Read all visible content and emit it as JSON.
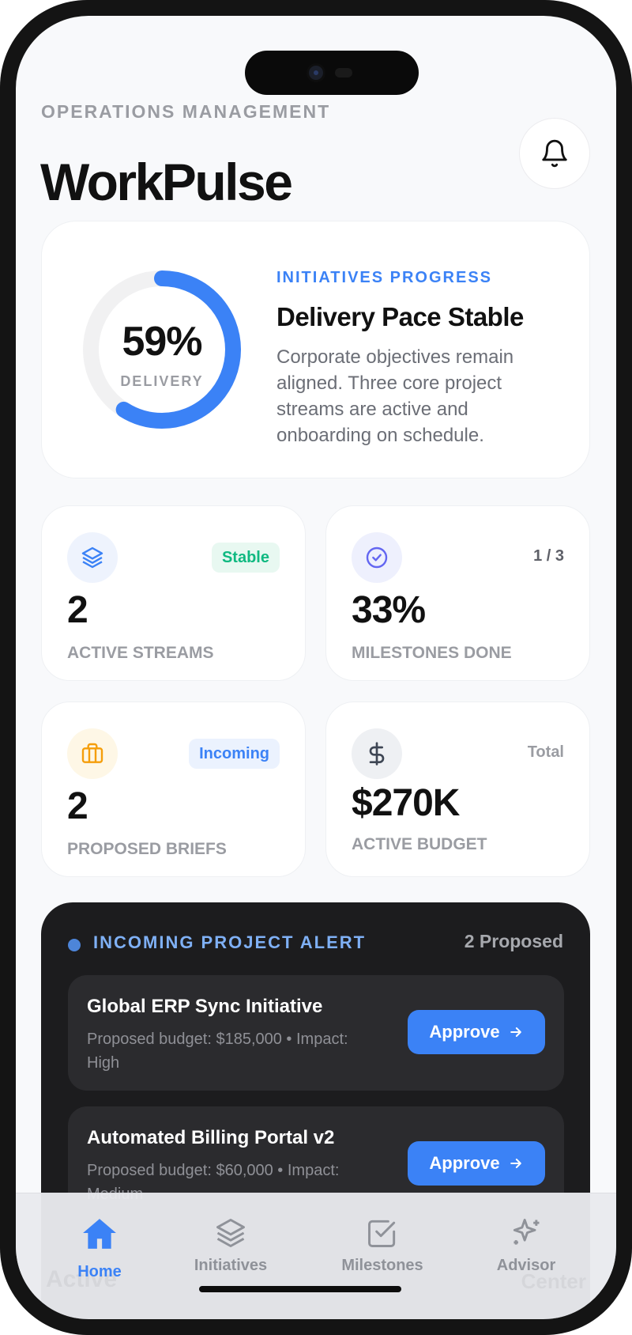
{
  "header": {
    "eyebrow": "OPERATIONS MANAGEMENT",
    "title": "WorkPulse",
    "bell_icon": "bell-icon"
  },
  "hero": {
    "progress": 59,
    "progress_text": "59%",
    "progress_label": "DELIVERY",
    "eyebrow": "INITIATIVES PROGRESS",
    "title": "Delivery Pace Stable",
    "description": "Corporate objectives remain aligned. Three core project streams are active and onboarding on schedule.",
    "accent": "#3b82f6"
  },
  "stats": [
    {
      "icon": "layers-icon",
      "badge": "Stable",
      "value": "2",
      "label": "ACTIVE STREAMS",
      "badge_color": "#10b981"
    },
    {
      "icon": "check-circle-icon",
      "tag": "1 / 3",
      "value": "33%",
      "label": "MILESTONES DONE"
    },
    {
      "icon": "briefcase-icon",
      "badge": "Incoming",
      "value": "2",
      "label": "PROPOSED BRIEFS",
      "badge_color": "#3b82f6"
    },
    {
      "icon": "dollar-icon",
      "tag": "Total",
      "value": "$270K",
      "label": "ACTIVE BUDGET"
    }
  ],
  "alert": {
    "title": "INCOMING PROJECT ALERT",
    "count": "2 Proposed",
    "proposals": [
      {
        "name": "Global ERP Sync Initiative",
        "meta": "Proposed budget: $185,000 • Impact: High",
        "action": "Approve"
      },
      {
        "name": "Automated Billing Portal v2",
        "meta": "Proposed budget: $60,000 • Impact: Medium",
        "action": "Approve"
      }
    ]
  },
  "tabbar": {
    "tabs": [
      {
        "label": "Home",
        "icon": "home-icon",
        "active": true
      },
      {
        "label": "Initiatives",
        "icon": "layers-icon",
        "active": false
      },
      {
        "label": "Milestones",
        "icon": "checkbox-icon",
        "active": false
      },
      {
        "label": "Advisor",
        "icon": "sparkles-icon",
        "active": false
      }
    ],
    "ghost_left": "Active",
    "ghost_right": "Center"
  }
}
